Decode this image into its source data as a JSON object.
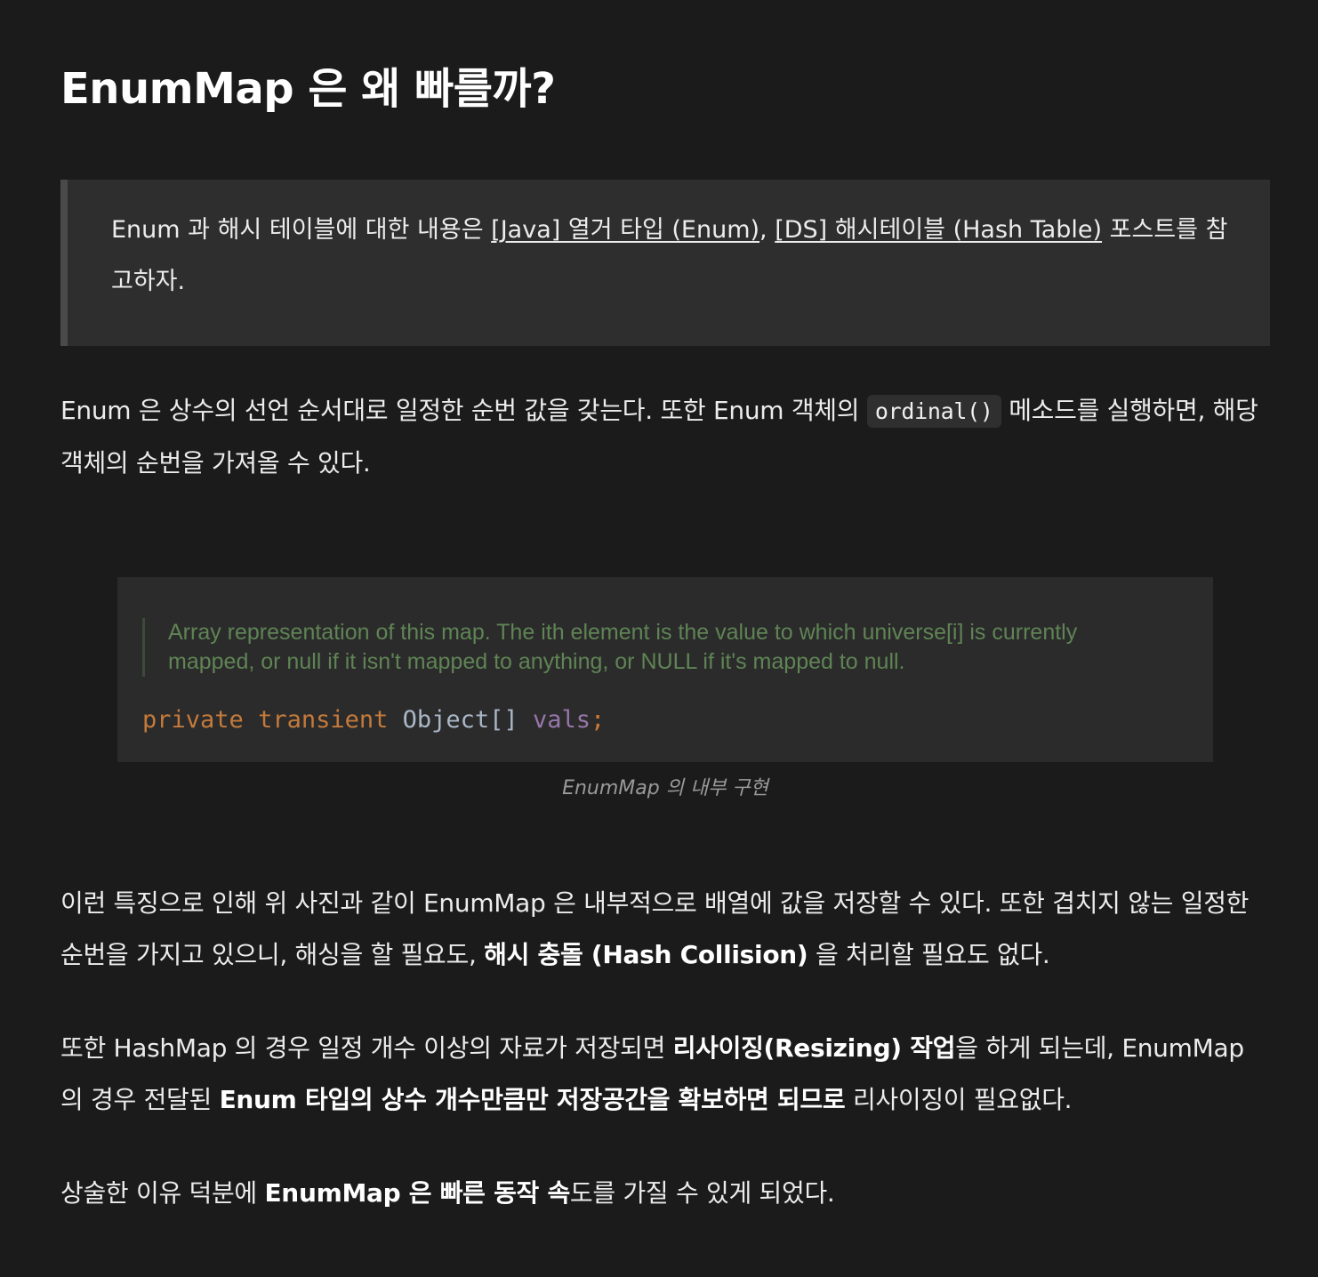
{
  "title": "EnumMap 은 왜 빠를까?",
  "quote": {
    "text_before": "Enum 과 해시 테이블에 대한 내용은 ",
    "link1": "[Java] 열거 타입 (Enum)",
    "separator": ", ",
    "link2": "[DS] 해시테이블 (Hash Table)",
    "text_after": " 포스트를 참고하자."
  },
  "para1": {
    "before": "Enum 은 상수의 선언 순서대로 일정한 순번 값을 갖는다. 또한 Enum 객체의 ",
    "code": "ordinal()",
    "after": " 메소드를 실행하면, 해당 객체의 순번을 가져올 수 있다."
  },
  "figure": {
    "comment_line1": "Array representation of this map. The ith element is the value to which universe[i] is currently",
    "comment_line2": "mapped, or null if it isn't mapped to anything, or NULL if it's mapped to null.",
    "code_private": "private",
    "code_transient": "transient",
    "code_type": "Object[]",
    "code_field": "vals",
    "code_semi": ";",
    "caption": "EnumMap 의 내부 구현"
  },
  "para2": {
    "before": "이런 특징으로 인해 위 사진과 같이 EnumMap 은 내부적으로 배열에 값을 저장할 수 있다. 또한 겹치지 않는 일정한 순번을 가지고 있으니, 해싱을 할 필요도, ",
    "bold": "해시 충돌 (Hash Collision)",
    "after": " 을 처리할 필요도 없다."
  },
  "para3": {
    "t1": "또한 HashMap 의 경우 일정 개수 이상의 자료가 저장되면 ",
    "b1": "리사이징(Resizing) 작업",
    "t2": "을 하게 되는데, EnumMap 의 경우 전달된 ",
    "b2": "Enum 타입의 상수 개수만큼만 저장공간을 확보하면 되므로",
    "t3": " 리사이징이 필요없다."
  },
  "para4": {
    "t1": "상술한 이유 덕분에 ",
    "b1": "EnumMap 은 빠른 동작 속",
    "t2": "도를 가질 수 있게 되었다."
  }
}
